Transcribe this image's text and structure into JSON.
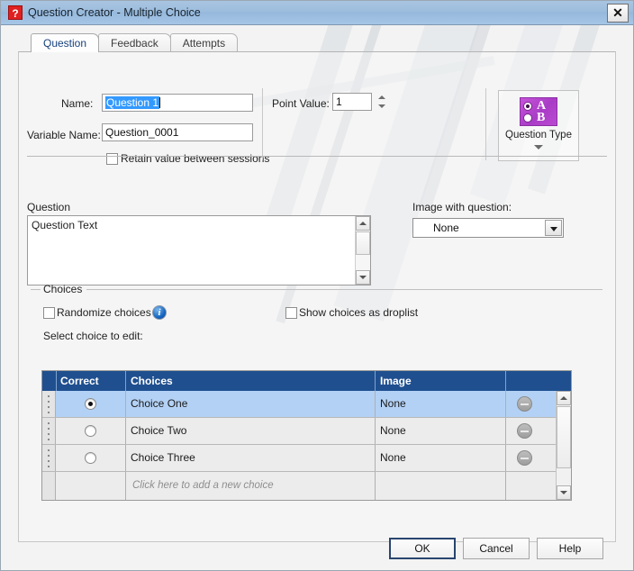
{
  "window": {
    "title": "Question Creator - Multiple Choice",
    "icon": "question-mark-icon",
    "close_label": "✕"
  },
  "tabs": [
    {
      "label": "Question",
      "active": true
    },
    {
      "label": "Feedback",
      "active": false
    },
    {
      "label": "Attempts",
      "active": false
    }
  ],
  "form": {
    "name_label": "Name:",
    "name_value": "Question 1",
    "name_selected": true,
    "variable_label": "Variable Name:",
    "variable_value": "Question_0001",
    "retain_label": "Retain value between sessions",
    "retain_checked": false,
    "point_value_label": "Point Value:",
    "point_value": "1",
    "question_type_label": "Question Type",
    "question_type_letters": [
      "A",
      "B"
    ]
  },
  "question": {
    "label": "Question",
    "text": "Question Text",
    "image_label": "Image with question:",
    "image_value": "None"
  },
  "choices": {
    "group_label": "Choices",
    "randomize_label": "Randomize choices",
    "randomize_checked": false,
    "info_icon": "info-icon",
    "droplist_label": "Show choices as droplist",
    "droplist_checked": false,
    "select_label": "Select choice to edit:",
    "columns": [
      "Correct",
      "Choices",
      "Image"
    ],
    "rows": [
      {
        "correct": true,
        "choice": "Choice One",
        "image": "None",
        "selected": true
      },
      {
        "correct": false,
        "choice": "Choice Two",
        "image": "None",
        "selected": false
      },
      {
        "correct": false,
        "choice": "Choice Three",
        "image": "None",
        "selected": false
      }
    ],
    "new_row_text": "Click here to add a new choice"
  },
  "footer": {
    "ok": "OK",
    "cancel": "Cancel",
    "help": "Help"
  },
  "colors": {
    "titlebar": "#9dbdde",
    "grid_header": "#1f4f8f",
    "row_selected": "#b3d1f5",
    "accent_purple": "#a93cc6",
    "icon_red": "#e02020",
    "info_blue": "#1565c0"
  }
}
